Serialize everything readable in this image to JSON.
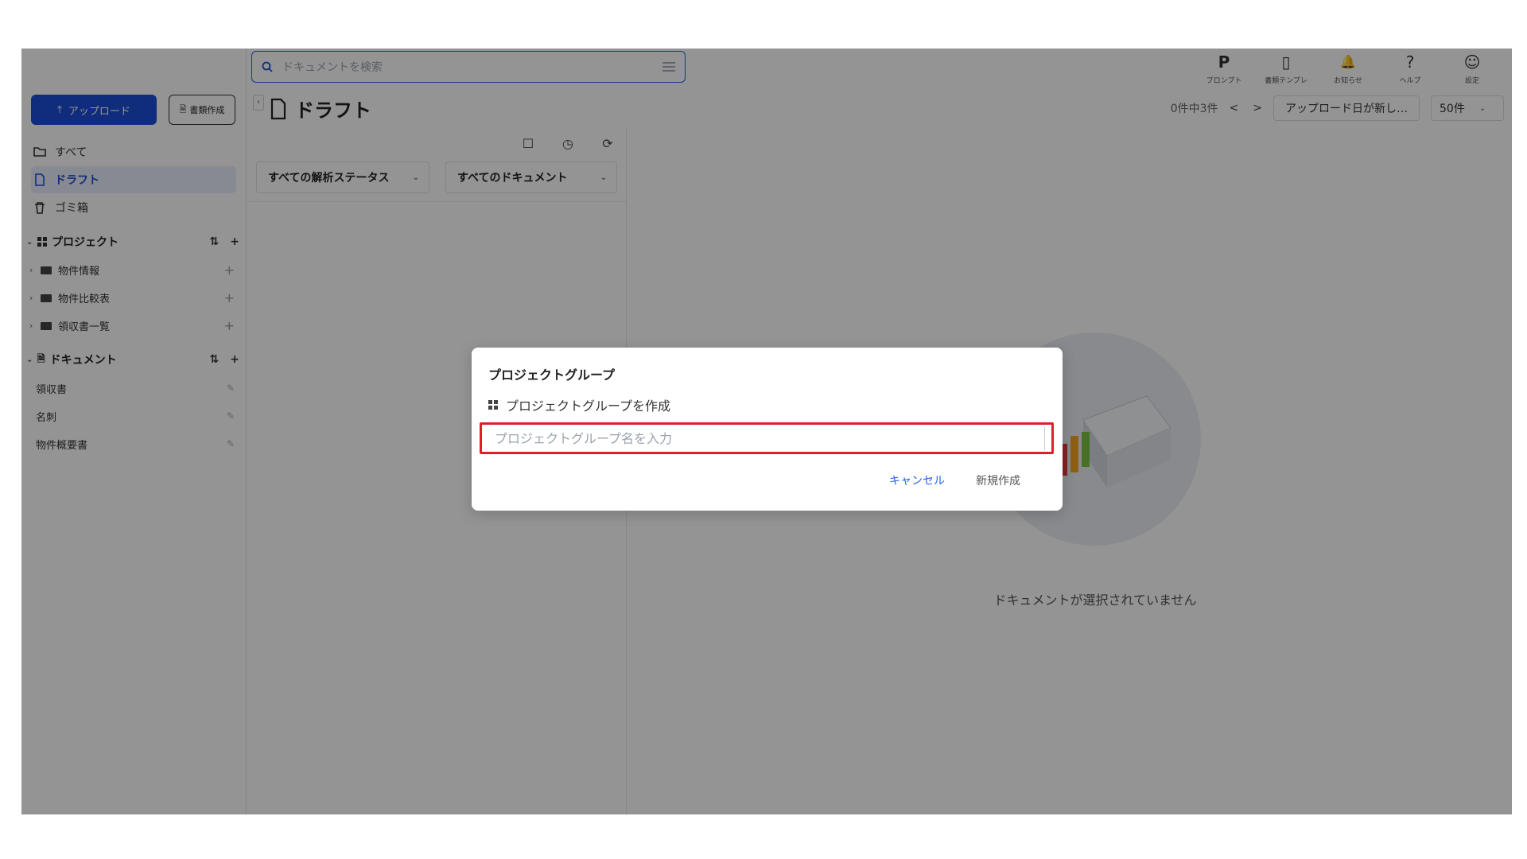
{
  "search": {
    "placeholder": "ドキュメントを検索"
  },
  "topbar": {
    "items": [
      {
        "icon": "P",
        "label": "プロンプト"
      },
      {
        "icon": "▯",
        "label": "書類テンプレ"
      },
      {
        "icon": "🔔",
        "label": "お知らせ"
      },
      {
        "icon": "?",
        "label": "ヘルプ"
      },
      {
        "icon": "☺",
        "label": "設定"
      }
    ]
  },
  "sidebar": {
    "upload_label": "アップロード",
    "doc_create_label": "書類作成",
    "nav": [
      {
        "label": "すべて"
      },
      {
        "label": "ドラフト"
      },
      {
        "label": "ゴミ箱"
      }
    ],
    "projects_header": "プロジェクト",
    "projects": [
      {
        "label": "物件情報"
      },
      {
        "label": "物件比較表"
      },
      {
        "label": "領収書一覧"
      }
    ],
    "documents_header": "ドキュメント",
    "documents": [
      {
        "label": "領収書"
      },
      {
        "label": "名刺"
      },
      {
        "label": "物件概要書"
      }
    ],
    "sort_icon": "⇅",
    "add_icon": "+"
  },
  "header": {
    "title": "ドラフト",
    "count": "0件中3件",
    "prev": "<",
    "next": ">",
    "sort_value": "アップロード日が新し…",
    "per_page": "50件"
  },
  "list": {
    "filter_status": "すべての解析ステータス",
    "filter_docs": "すべてのドキュメント"
  },
  "empty": {
    "text": "ドキュメントが選択されていません"
  },
  "dialog": {
    "title": "プロジェクトグループ",
    "subtitle": "プロジェクトグループを作成",
    "input_placeholder": "プロジェクトグループ名を入力",
    "input_value": "",
    "cancel_label": "キャンセル",
    "create_label": "新規作成"
  },
  "colors": {
    "accent": "#1d4ed8",
    "highlight": "#e11d2a"
  }
}
